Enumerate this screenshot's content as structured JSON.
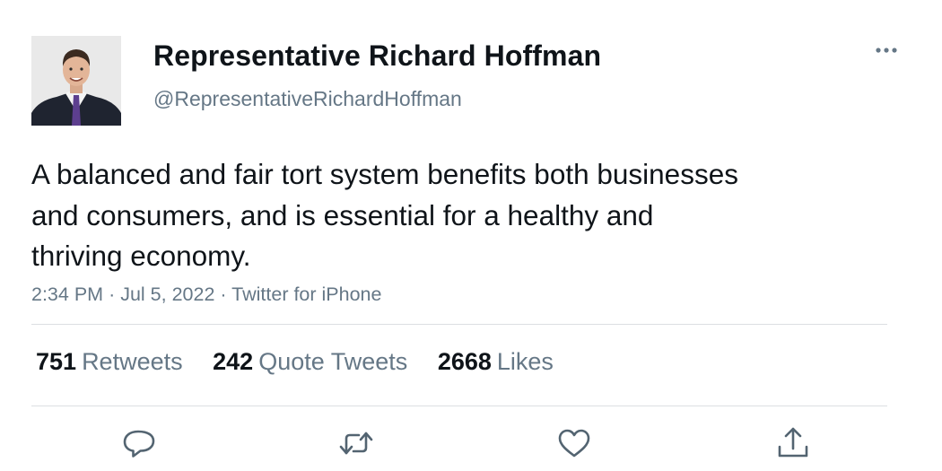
{
  "user": {
    "display_name": "Representative Richard Hoffman",
    "handle": "@RepresentativeRichardHoffman"
  },
  "tweet": {
    "text": "A balanced and fair tort system benefits both businesses and consumers, and is essential for a healthy and thriving economy.",
    "time": "2:34 PM",
    "date": "Jul 5, 2022",
    "source": "Twitter for iPhone",
    "separator": "·"
  },
  "stats": {
    "retweets": {
      "count": "751",
      "label": "Retweets"
    },
    "quote_tweets": {
      "count": "242",
      "label": "Quote Tweets"
    },
    "likes": {
      "count": "2668",
      "label": "Likes"
    }
  },
  "actions": [
    {
      "name": "reply",
      "icon": "reply-icon"
    },
    {
      "name": "retweet",
      "icon": "retweet-icon"
    },
    {
      "name": "like",
      "icon": "heart-icon"
    },
    {
      "name": "share",
      "icon": "share-icon"
    }
  ],
  "colors": {
    "text_primary": "#0f1419",
    "text_secondary": "#657786",
    "divider": "#dcdfe2",
    "icon": "#536471"
  }
}
